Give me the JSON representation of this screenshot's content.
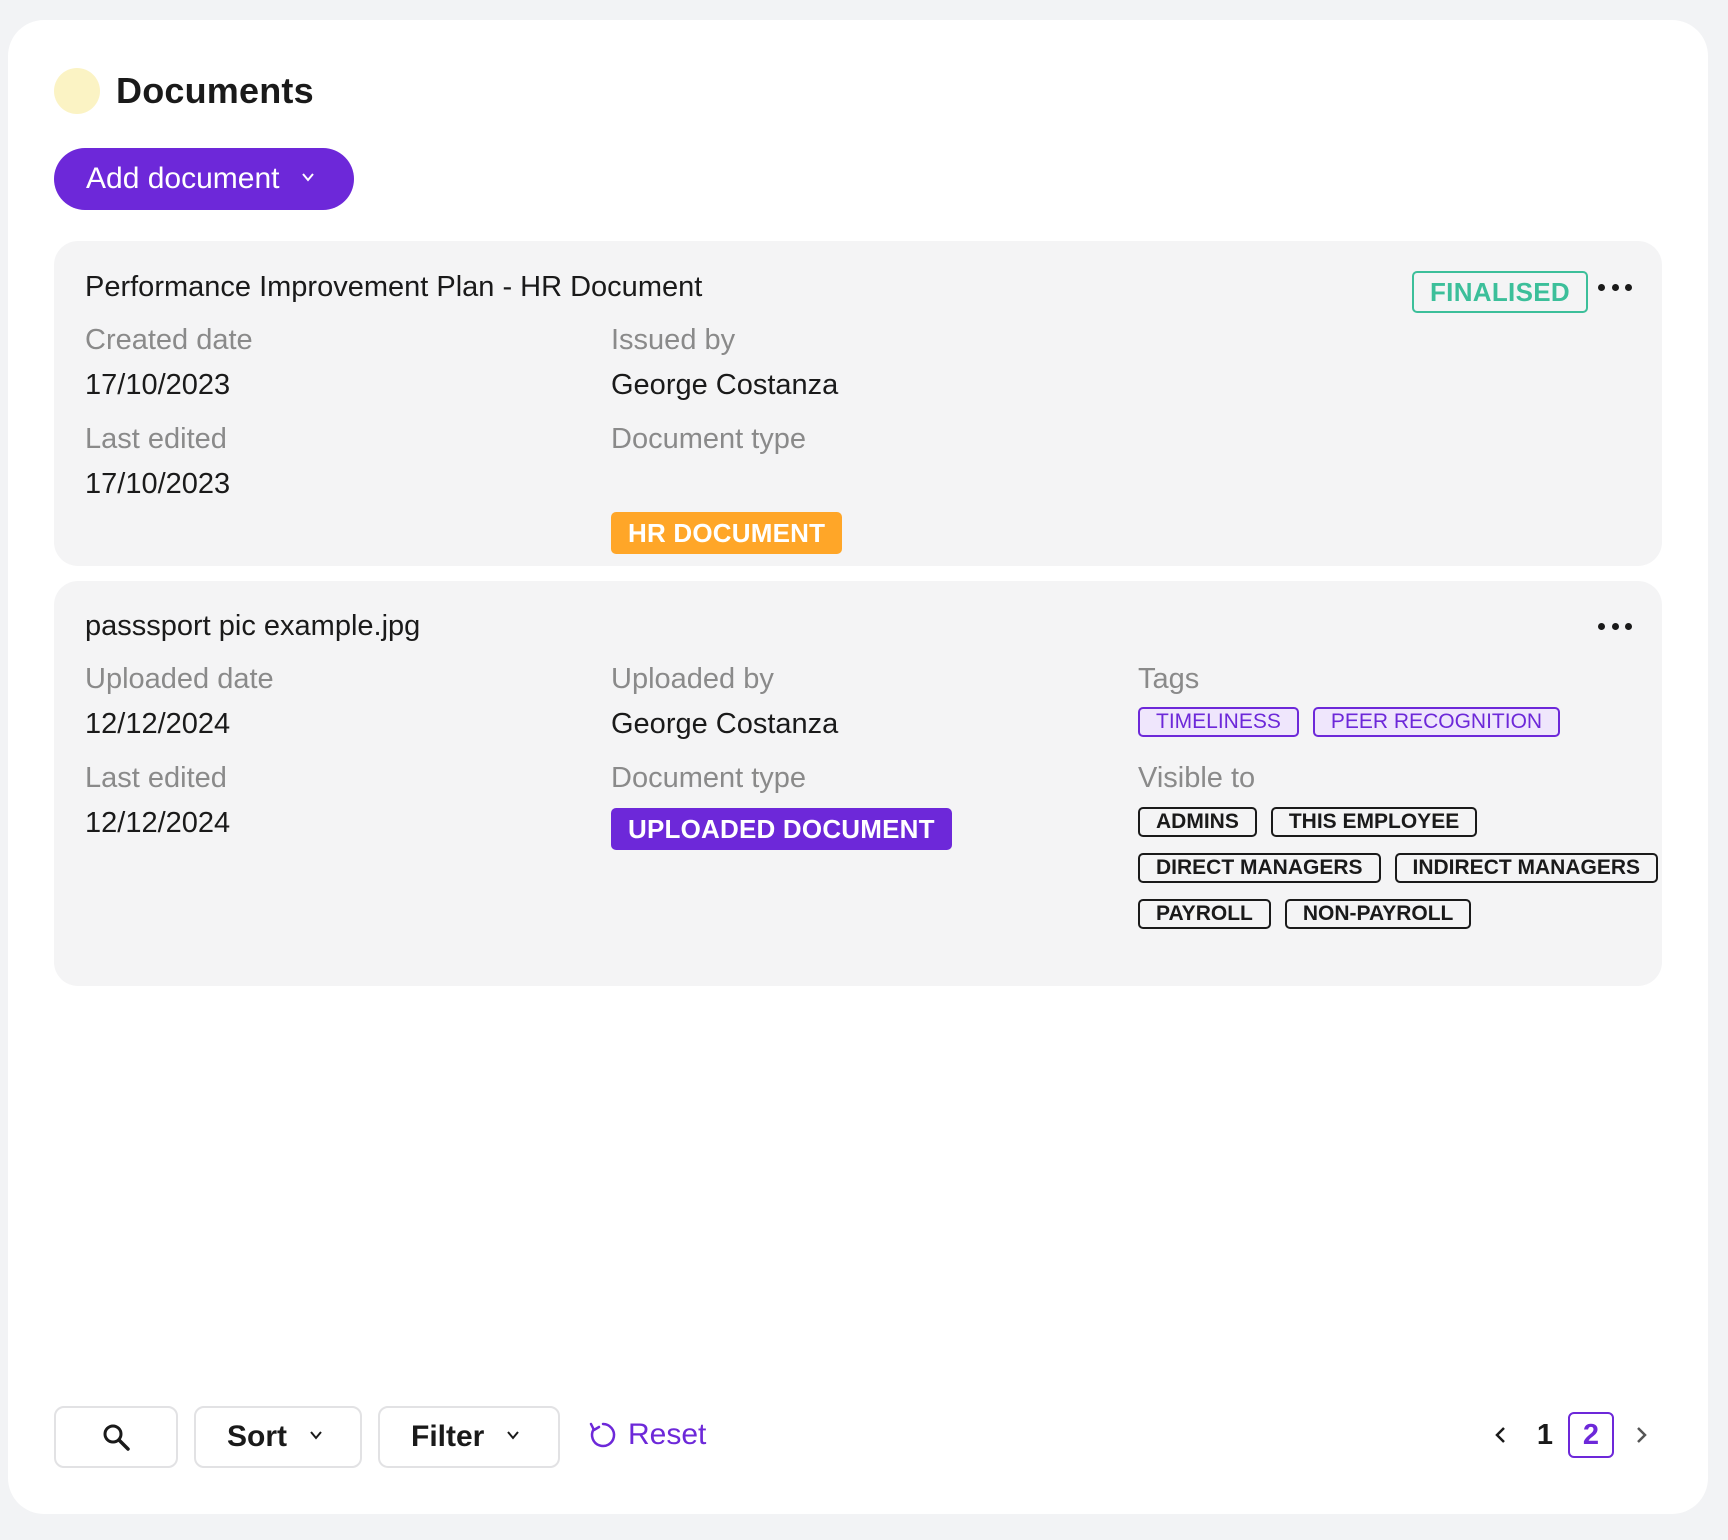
{
  "header": {
    "title": "Documents"
  },
  "actions": {
    "add_document_label": "Add document"
  },
  "documents": [
    {
      "title": "Performance Improvement Plan - HR Document",
      "status": "FINALISED",
      "created_label": "Created date",
      "created_value": "17/10/2023",
      "issued_label": "Issued by",
      "issued_value": "George Costanza",
      "edited_label": "Last edited",
      "edited_value": "17/10/2023",
      "type_label": "Document type",
      "type_value": "HR DOCUMENT",
      "type_color": "#ffa628"
    },
    {
      "title": "passsport pic example.jpg",
      "uploaded_label": "Uploaded date",
      "uploaded_value": "12/12/2024",
      "uploaded_by_label": "Uploaded by",
      "uploaded_by_value": "George Costanza",
      "edited_label": "Last edited",
      "edited_value": "12/12/2024",
      "type_label": "Document type",
      "type_value": "UPLOADED DOCUMENT",
      "type_color": "#6d28d9",
      "tags_label": "Tags",
      "tags": [
        "TIMELINESS",
        "PEER RECOGNITION"
      ],
      "visible_label": "Visible to",
      "visible_to": [
        "ADMINS",
        "THIS EMPLOYEE",
        "DIRECT MANAGERS",
        "INDIRECT MANAGERS",
        "PAYROLL",
        "NON-PAYROLL"
      ]
    }
  ],
  "toolbar": {
    "search_icon": "search-icon",
    "sort_label": "Sort",
    "filter_label": "Filter",
    "reset_label": "Reset"
  },
  "pagination": {
    "pages": [
      "1",
      "2"
    ],
    "current": "2"
  },
  "colors": {
    "accent": "#6d28d9",
    "status_finalised": "#3cbf9a",
    "hr_document": "#ffa628"
  }
}
